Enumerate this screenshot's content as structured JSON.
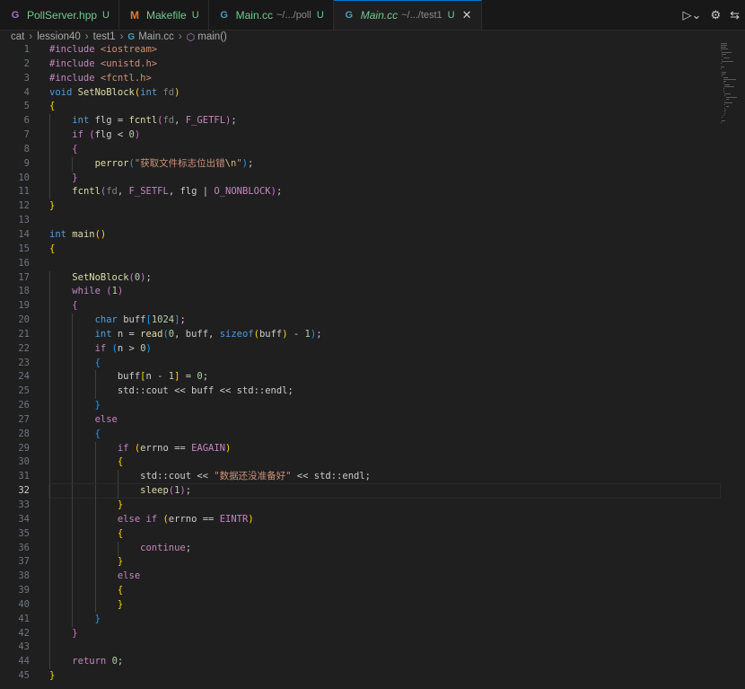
{
  "tabs": [
    {
      "name": "PollServer.hpp",
      "path": "",
      "badge": "U",
      "icon": "cpp-file-icon",
      "active": false
    },
    {
      "name": "Makefile",
      "path": "",
      "badge": "U",
      "icon": "makefile-icon",
      "active": false
    },
    {
      "name": "Main.cc",
      "path": "~/.../poll",
      "badge": "U",
      "icon": "cc-file-icon",
      "active": false
    },
    {
      "name": "Main.cc",
      "path": "~/.../test1",
      "badge": "U",
      "icon": "cc-file-icon",
      "active": true
    }
  ],
  "breadcrumb": [
    "cat",
    "lession40",
    "test1",
    "Main.cc",
    "main()"
  ],
  "code_lines": [
    "#include <iostream>",
    "#include <unistd.h>",
    "#include <fcntl.h>",
    "void SetNoBlock(int fd)",
    "{",
    "    int flg = fcntl(fd, F_GETFL);",
    "    if (flg < 0)",
    "    {",
    "        perror(\"获取文件标志位出错\\n\");",
    "    }",
    "    fcntl(fd, F_SETFL, flg | O_NONBLOCK);",
    "}",
    "",
    "int main()",
    "{",
    "",
    "    SetNoBlock(0);",
    "    while (1)",
    "    {",
    "        char buff[1024];",
    "        int n = read(0, buff, sizeof(buff) - 1);",
    "        if (n > 0)",
    "        {",
    "            buff[n - 1] = 0;",
    "            std::cout << buff << std::endl;",
    "        }",
    "        else",
    "        {",
    "            if (errno == EAGAIN)",
    "            {",
    "                std::cout << \"数据还没准备好\" << std::endl;",
    "                sleep(1);",
    "            }",
    "            else if (errno == EINTR)",
    "            {",
    "                continue;",
    "            }",
    "            else",
    "            {",
    "            }",
    "        }",
    "    }",
    "",
    "    return 0;",
    "}"
  ],
  "active_line": 32,
  "colors": {
    "accent": "#0078d4",
    "untracked": "#73c991",
    "background": "#1f1f1f"
  }
}
